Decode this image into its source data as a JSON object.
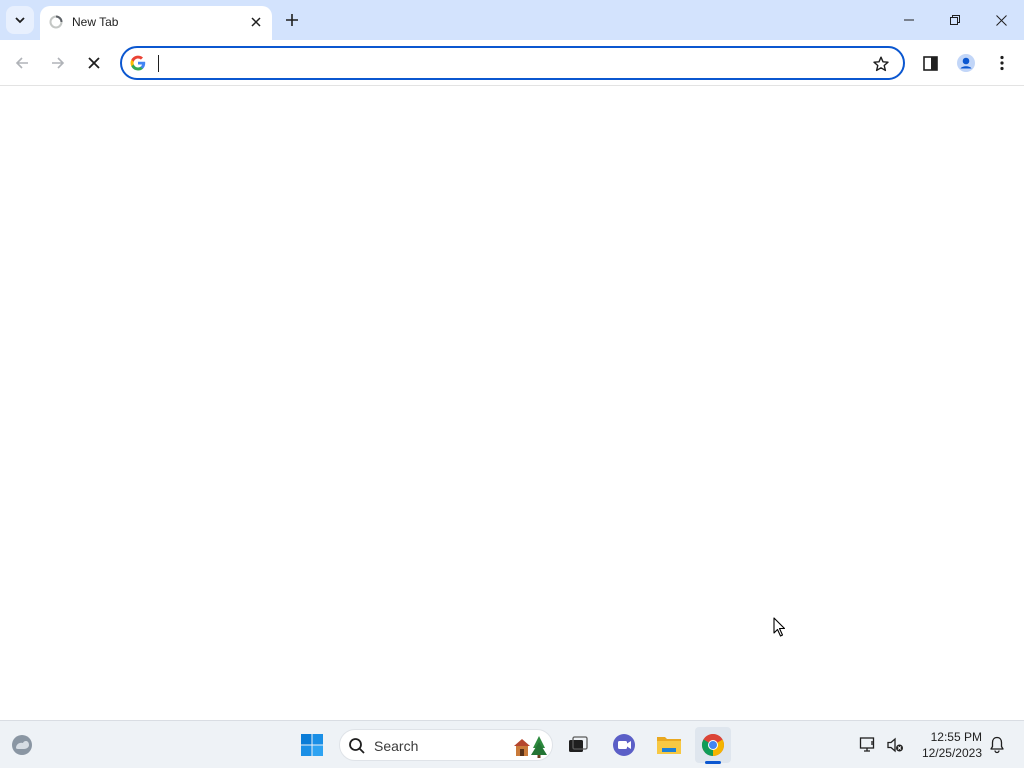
{
  "browser": {
    "tab": {
      "title": "New Tab"
    },
    "omnibox": {
      "value": "",
      "placeholder": ""
    }
  },
  "taskbar": {
    "search_label": "Search",
    "clock": {
      "time": "12:55 PM",
      "date": "12/25/2023"
    }
  },
  "icons": {
    "tab_search": "chevron-down-icon",
    "favicon": "loading-spinner-icon",
    "tab_close": "close-icon",
    "new_tab": "plus-icon",
    "minimize": "minimize-icon",
    "restore": "restore-icon",
    "close_window": "close-icon",
    "back": "arrow-left-icon",
    "forward": "arrow-right-icon",
    "stop": "close-icon",
    "google": "google-g-icon",
    "bookmark": "star-icon",
    "side_panel": "side-panel-icon",
    "profile": "person-icon",
    "menu": "kebab-menu-icon",
    "widgets": "weather-widget-icon",
    "start": "windows-start-icon",
    "task_view": "task-view-icon",
    "teams": "teams-chat-icon",
    "file_explorer": "folder-icon",
    "chrome": "chrome-icon",
    "network": "network-disconnected-icon",
    "sound": "speaker-muted-icon",
    "notifications": "bell-icon"
  },
  "colors": {
    "accent": "#0b57d0",
    "tabstrip": "#d3e3fd",
    "taskbar": "#eef2f6"
  }
}
